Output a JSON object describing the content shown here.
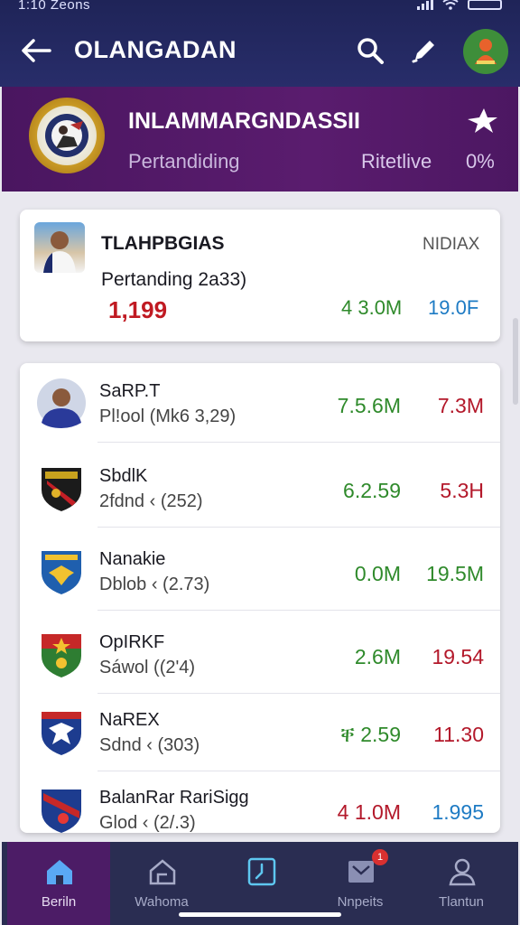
{
  "status_bar": {
    "time": "1:10 Zeons",
    "battery_icon": "battery-icon",
    "wifi_icon": "wifi-icon"
  },
  "app_bar": {
    "title": "OLANGADAN",
    "back_icon": "arrow-left-icon",
    "search_icon": "search-icon",
    "edit_icon": "pencil-icon",
    "avatar_icon": "user-avatar-icon"
  },
  "league": {
    "title": "INLAMMARGNDASSII",
    "subtitle": "Pertandiding",
    "live_label": "Ritetlive",
    "percent": "0%",
    "crest_icon": "league-crest-icon",
    "star_icon": "star-icon"
  },
  "featured": {
    "name": "TLAHPBGIAS",
    "right_label": "NIDIAX",
    "subtitle": "Pertanding 2a33)",
    "value": "1,199",
    "value_green": "4 3.0M",
    "value_blue": "19.0F"
  },
  "rows": [
    {
      "name": "SaRP.T",
      "sub": "Pl!ool (Mk6 3,29)",
      "v1": "7.5.6M",
      "v1_color": "green",
      "v2": "7.3M",
      "v2_color": "red",
      "logo": "player-avatar-icon"
    },
    {
      "name": "SbdlK",
      "sub": "2fdnd ‹ (252)",
      "v1": "6.2.59",
      "v1_color": "green",
      "v2": "5.3H",
      "v2_color": "red",
      "logo": "club-crest-icon"
    },
    {
      "name": "Nanakie",
      "sub": "Dblob ‹ (2.73)",
      "v1": "0.0M",
      "v1_color": "green",
      "v2": "19.5M",
      "v2_color": "green",
      "logo": "club-crest-icon"
    },
    {
      "name": "OpIRKF",
      "sub": "Sáwol ((2'4)",
      "v1": "2.6M",
      "v1_color": "green",
      "v2": "19.54",
      "v2_color": "red",
      "logo": "club-crest-icon"
    },
    {
      "name": "NaREX",
      "sub": "Sdnd ‹ (303)",
      "v1": "ቐ 2.59",
      "v1_color": "green",
      "v2": "11.30",
      "v2_color": "red",
      "logo": "club-crest-icon"
    },
    {
      "name": "BalanRar RariSigg",
      "sub": "Glod ‹ (2/.3)",
      "v1": "4 1.0M",
      "v1_color": "red",
      "v2": "1.995",
      "v2_color": "blue",
      "logo": "club-crest-icon"
    }
  ],
  "bottom_nav": [
    {
      "label": "Beriln",
      "icon": "home-icon",
      "active": true
    },
    {
      "label": "Wahoma",
      "icon": "house-outline-icon",
      "active": false
    },
    {
      "label": "",
      "icon": "clock-calendar-icon",
      "active": false
    },
    {
      "label": "Nnpeits",
      "icon": "report-icon",
      "active": false,
      "badge": "1"
    },
    {
      "label": "Tlantun",
      "icon": "user-icon",
      "active": false
    }
  ],
  "colors": {
    "topbar": "#282d6a",
    "league_bg": "#5a1c6e",
    "green": "#2f8a2b",
    "red": "#b3182a",
    "blue": "#1e7bc4",
    "nav_active": "#4c1c66"
  }
}
